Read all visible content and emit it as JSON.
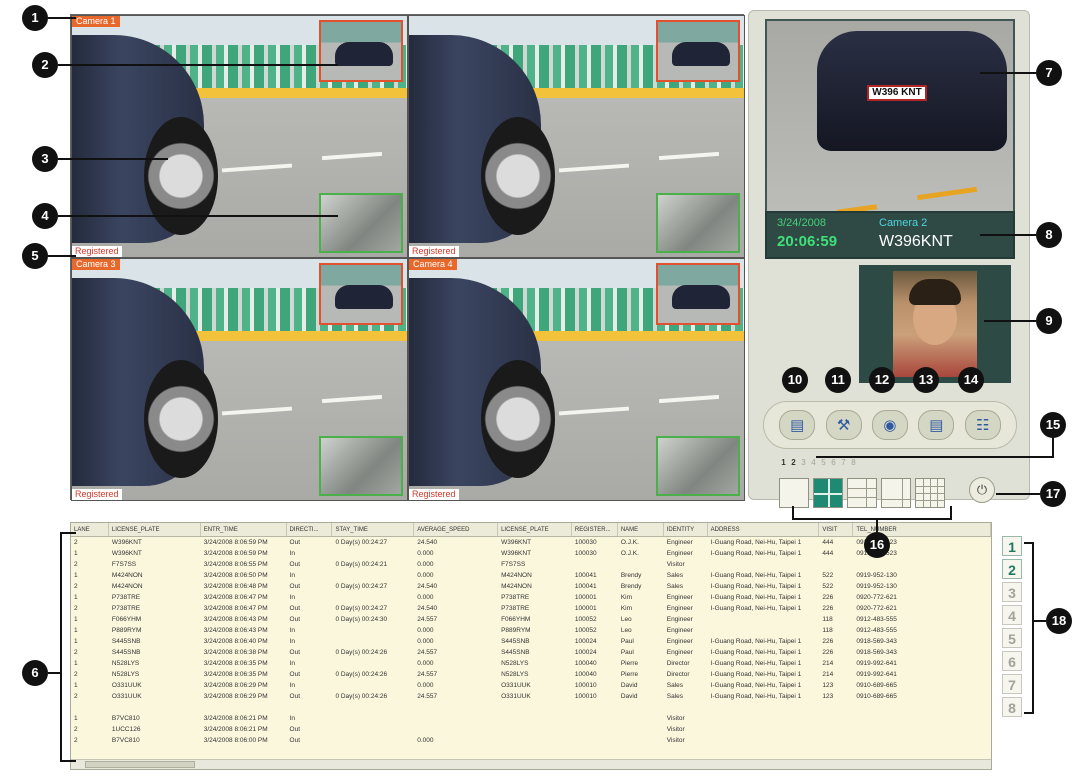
{
  "cameras": [
    {
      "label": "Camera 1",
      "status": "Registered"
    },
    {
      "label": "Camera 2",
      "status": "Registered"
    },
    {
      "label": "Camera 3",
      "status": "Registered"
    },
    {
      "label": "Camera 4",
      "status": "Registered"
    }
  ],
  "detail": {
    "plate_text": "W396 KNT",
    "date": "3/24/2008",
    "time": "20:06:59",
    "camera": "Camera 2",
    "plate": "W396KNT"
  },
  "toolbar": {
    "buttons": [
      {
        "icon": "settings-monitor-icon"
      },
      {
        "icon": "tools-icon"
      },
      {
        "icon": "camera-snapshot-icon"
      },
      {
        "icon": "report-icon"
      },
      {
        "icon": "network-icon"
      }
    ]
  },
  "page_tabs": [
    "1",
    "2",
    "3",
    "4",
    "5",
    "6",
    "7",
    "8"
  ],
  "active_page_tab": "2",
  "layouts": [
    "single",
    "quad",
    "six",
    "eight",
    "sixteen"
  ],
  "table": {
    "columns": [
      "LANE",
      "LICENSE_PLATE",
      "ENTR_TIME",
      "DIRECTI...",
      "STAY_TIME",
      "AVERAGE_SPEED",
      "LICENSE_PLATE",
      "REGISTER...",
      "NAME",
      "IDENTITY",
      "ADDRESS",
      "VISIT",
      "TEL_NUMBER"
    ],
    "rows": [
      [
        "2",
        "W396KNT",
        "3/24/2008 8:06:59 PM",
        "Out",
        "0 Day(s) 00:24:27",
        "24.540",
        "W396KNT",
        "100030",
        "O.J.K.",
        "Engineer",
        "I-Guang Road, Nei-Hu, Taipei 1",
        "444",
        "0919-387-523"
      ],
      [
        "1",
        "W396KNT",
        "3/24/2008 8:06:59 PM",
        "In",
        "",
        "0.000",
        "W396KNT",
        "100030",
        "O.J.K.",
        "Engineer",
        "I-Guang Road, Nei-Hu, Taipei 1",
        "444",
        "0919-387-523"
      ],
      [
        "2",
        "F7S7SS",
        "3/24/2008 8:06:55 PM",
        "Out",
        "0 Day(s) 00:24:21",
        "0.000",
        "F7S7SS",
        "",
        "",
        "Visitor",
        "",
        "",
        ""
      ],
      [
        "1",
        "M424NON",
        "3/24/2008 8:06:50 PM",
        "In",
        "",
        "0.000",
        "M424NON",
        "100041",
        "Brendy",
        "Sales",
        "I-Guang Road, Nei-Hu, Taipei 1",
        "522",
        "0919-952-130"
      ],
      [
        "2",
        "M424NON",
        "3/24/2008 8:06:48 PM",
        "Out",
        "0 Day(s) 00:24:27",
        "24.540",
        "M424NON",
        "100041",
        "Brendy",
        "Sales",
        "I-Guang Road, Nei-Hu, Taipei 1",
        "522",
        "0919-952-130"
      ],
      [
        "1",
        "P738TRE",
        "3/24/2008 8:06:47 PM",
        "In",
        "",
        "0.000",
        "P738TRE",
        "100001",
        "Kim",
        "Engineer",
        "I-Guang Road, Nei-Hu, Taipei 1",
        "226",
        "0920-772-621"
      ],
      [
        "2",
        "P738TRE",
        "3/24/2008 8:06:47 PM",
        "Out",
        "0 Day(s) 00:24:27",
        "24.540",
        "P738TRE",
        "100001",
        "Kim",
        "Engineer",
        "I-Guang Road, Nei-Hu, Taipei 1",
        "226",
        "0920-772-621"
      ],
      [
        "1",
        "F066YHM",
        "3/24/2008 8:06:43 PM",
        "Out",
        "0 Day(s) 00:24:30",
        "24.557",
        "F066YHM",
        "100052",
        "Leo",
        "Engineer",
        "",
        "118",
        "0912-483-555"
      ],
      [
        "1",
        "P889RYM",
        "3/24/2008 8:06:43 PM",
        "In",
        "",
        "0.000",
        "P889RYM",
        "100052",
        "Leo",
        "Engineer",
        "",
        "118",
        "0912-483-555"
      ],
      [
        "1",
        "S445SNB",
        "3/24/2008 8:06:40 PM",
        "In",
        "",
        "0.000",
        "S445SNB",
        "100024",
        "Paul",
        "Engineer",
        "I-Guang Road, Nei-Hu, Taipei 1",
        "226",
        "0918-569-343"
      ],
      [
        "2",
        "S445SNB",
        "3/24/2008 8:06:38 PM",
        "Out",
        "0 Day(s) 00:24:26",
        "24.557",
        "S445SNB",
        "100024",
        "Paul",
        "Engineer",
        "I-Guang Road, Nei-Hu, Taipei 1",
        "226",
        "0918-569-343"
      ],
      [
        "1",
        "N528LYS",
        "3/24/2008 8:06:35 PM",
        "In",
        "",
        "0.000",
        "N528LYS",
        "100040",
        "Pierre",
        "Director",
        "I-Guang Road, Nei-Hu, Taipei 1",
        "214",
        "0919-992-641"
      ],
      [
        "2",
        "N528LYS",
        "3/24/2008 8:06:35 PM",
        "Out",
        "0 Day(s) 00:24:26",
        "24.557",
        "N528LYS",
        "100040",
        "Pierre",
        "Director",
        "I-Guang Road, Nei-Hu, Taipei 1",
        "214",
        "0919-992-641"
      ],
      [
        "1",
        "O331UUK",
        "3/24/2008 8:06:29 PM",
        "In",
        "",
        "0.000",
        "O331UUK",
        "100010",
        "David",
        "Sales",
        "I-Guang Road, Nei-Hu, Taipei 1",
        "123",
        "0910-689-665"
      ],
      [
        "2",
        "O331UUK",
        "3/24/2008 8:06:29 PM",
        "Out",
        "0 Day(s) 00:24:26",
        "24.557",
        "O331UUK",
        "100010",
        "David",
        "Sales",
        "I-Guang Road, Nei-Hu, Taipei 1",
        "123",
        "0910-689-665"
      ],
      [
        "",
        "",
        "",
        "",
        "",
        "",
        "",
        "",
        "",
        "",
        "",
        "",
        ""
      ],
      [
        "1",
        "B7VC810",
        "3/24/2008 8:06:21 PM",
        "In",
        "",
        "",
        "",
        "",
        "",
        "Visitor",
        "",
        "",
        ""
      ],
      [
        "2",
        "1UCC126",
        "3/24/2008 8:06:21 PM",
        "Out",
        "",
        "",
        "",
        "",
        "",
        "Visitor",
        "",
        "",
        ""
      ],
      [
        "2",
        "B7VC810",
        "3/24/2008 8:06:00 PM",
        "Out",
        "",
        "0.000",
        "",
        "",
        "",
        "Visitor",
        "",
        "",
        ""
      ]
    ]
  },
  "side_pages": [
    "1",
    "2",
    "3",
    "4",
    "5",
    "6",
    "7",
    "8"
  ],
  "active_side_page": "1",
  "callouts": [
    "1",
    "2",
    "3",
    "4",
    "5",
    "6",
    "7",
    "8",
    "9",
    "10",
    "11",
    "12",
    "13",
    "14",
    "15",
    "16",
    "17",
    "18"
  ]
}
